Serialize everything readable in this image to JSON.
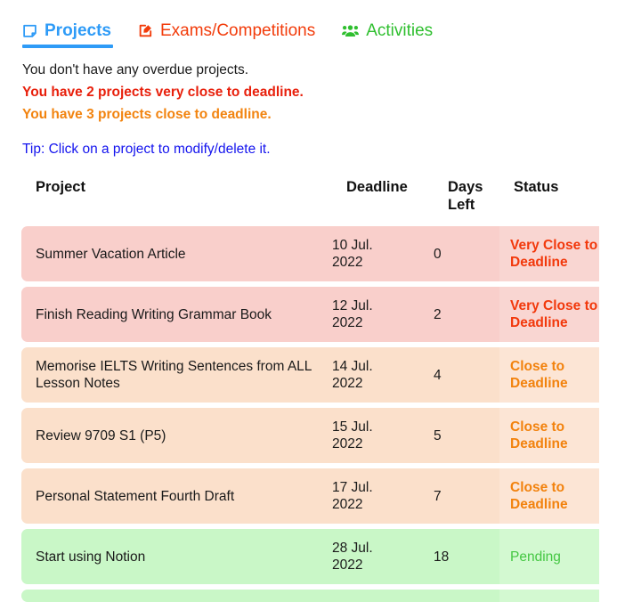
{
  "tabs": [
    {
      "id": "projects",
      "label": "Projects",
      "icon": "note-icon",
      "color": "#2e9bf7",
      "active": true
    },
    {
      "id": "exams",
      "label": "Exams/Competitions",
      "icon": "edit-square-icon",
      "color": "#f23c0b",
      "active": false
    },
    {
      "id": "activities",
      "label": "Activities",
      "icon": "users-group-icon",
      "color": "#2fbf2f",
      "active": false
    }
  ],
  "notices": {
    "overdue": "You don't have any overdue projects.",
    "very_close": "You have 2 projects very close to deadline.",
    "close": "You have 3 projects close to deadline."
  },
  "tip": "Tip: Click on a project to modify/delete it.",
  "table": {
    "headers": {
      "project": "Project",
      "deadline": "Deadline",
      "days_left": "Days Left",
      "status": "Status"
    },
    "rows": [
      {
        "project": "Summer Vacation Article",
        "deadline_day": "10 Jul.",
        "deadline_year": "2022",
        "days_left": "0",
        "status": "Very Close to Deadline",
        "variant": "veryclose"
      },
      {
        "project": "Finish Reading Writing Grammar Book",
        "deadline_day": "12 Jul.",
        "deadline_year": "2022",
        "days_left": "2",
        "status": "Very Close to Deadline",
        "variant": "veryclose"
      },
      {
        "project": "Memorise IELTS Writing Sentences from ALL Lesson Notes",
        "deadline_day": "14 Jul.",
        "deadline_year": "2022",
        "days_left": "4",
        "status": "Close to Deadline",
        "variant": "close"
      },
      {
        "project": "Review 9709 S1 (P5)",
        "deadline_day": "15 Jul.",
        "deadline_year": "2022",
        "days_left": "5",
        "status": "Close to Deadline",
        "variant": "close"
      },
      {
        "project": "Personal Statement Fourth Draft",
        "deadline_day": "17 Jul.",
        "deadline_year": "2022",
        "days_left": "7",
        "status": "Close to Deadline",
        "variant": "close"
      },
      {
        "project": "Start using Notion",
        "deadline_day": "28 Jul.",
        "deadline_year": "2022",
        "days_left": "18",
        "status": "Pending",
        "variant": "pending"
      },
      {
        "project": "",
        "deadline_day": "",
        "deadline_year": "",
        "days_left": "",
        "status": "",
        "variant": "pending",
        "partial": true
      }
    ]
  },
  "colors": {
    "tab_active": "#2e9bf7",
    "exams": "#f23c0b",
    "activities": "#2fbf2f",
    "very_close_text": "#e8200c",
    "close_text": "#f28410",
    "pending_text": "#44c742",
    "tip_link": "#1414ee",
    "row_veryclose_bg": "#f9cfcb",
    "row_close_bg": "#fbe0cb",
    "row_pending_bg": "#c9f7c7"
  }
}
